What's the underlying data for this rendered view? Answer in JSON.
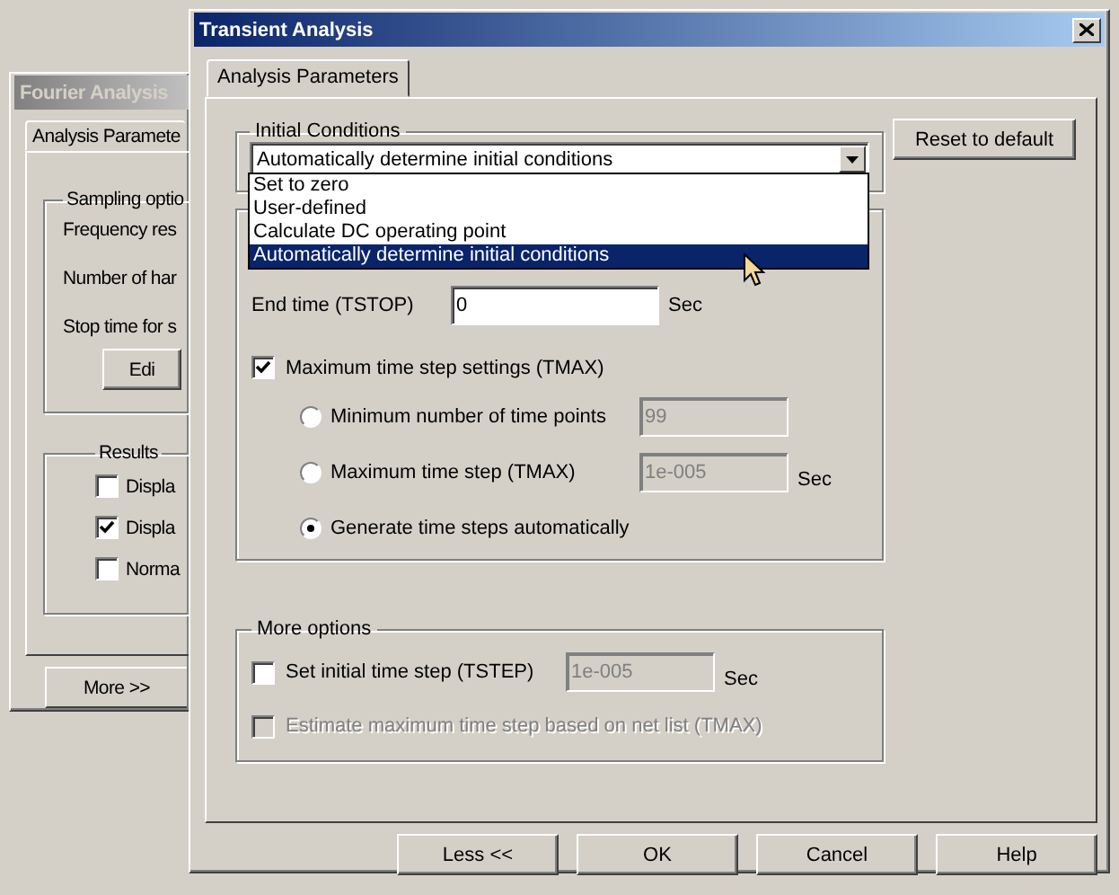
{
  "background_window": {
    "title": "Fourier Analysis",
    "tabs": [
      {
        "label": "Analysis Paramete",
        "selected": true
      }
    ],
    "sampling_group": {
      "legend": "Sampling optio",
      "labels": [
        "Frequency res",
        "Number of har",
        "Stop time for s"
      ],
      "button": "Edi"
    },
    "results_group": {
      "legend": "Results",
      "options": [
        {
          "label": "Displa",
          "checked": false
        },
        {
          "label": "Displa",
          "checked": true
        },
        {
          "label": "Norma",
          "checked": false
        }
      ]
    },
    "more_button": "More >>"
  },
  "dialog": {
    "title": "Transient Analysis",
    "tabs": [
      {
        "label": "Analysis Parameters",
        "selected": true
      }
    ],
    "initial_conditions": {
      "legend": "Initial Conditions",
      "value": "Automatically determine initial conditions",
      "expanded": true,
      "options": [
        {
          "label": "Set to zero",
          "selected": false
        },
        {
          "label": "User-defined",
          "selected": false
        },
        {
          "label": "Calculate DC operating point",
          "selected": false
        },
        {
          "label": "Automatically determine initial conditions",
          "selected": true
        }
      ]
    },
    "reset_button": "Reset to default",
    "end_time": {
      "label": "End time (TSTOP)",
      "value": "0",
      "unit": "Sec"
    },
    "tmax": {
      "label": "Maximum time step settings (TMAX)",
      "checked": true,
      "options": [
        {
          "label": "Minimum number of time points",
          "selected": false,
          "value": "99",
          "disabled": true
        },
        {
          "label": "Maximum time step (TMAX)",
          "selected": false,
          "value": "1e-005",
          "disabled": true,
          "unit": "Sec"
        },
        {
          "label": "Generate time steps automatically",
          "selected": true
        }
      ]
    },
    "more_options": {
      "legend": "More options",
      "items": [
        {
          "label": "Set initial time step (TSTEP)",
          "checked": false,
          "disabled": false,
          "value": "1e-005",
          "value_disabled": true,
          "unit": "Sec"
        },
        {
          "label": "Estimate maximum time step based on net list (TMAX)",
          "checked": false,
          "disabled": true
        }
      ]
    },
    "buttons": [
      "Less <<",
      "OK",
      "Cancel",
      "Help"
    ]
  }
}
